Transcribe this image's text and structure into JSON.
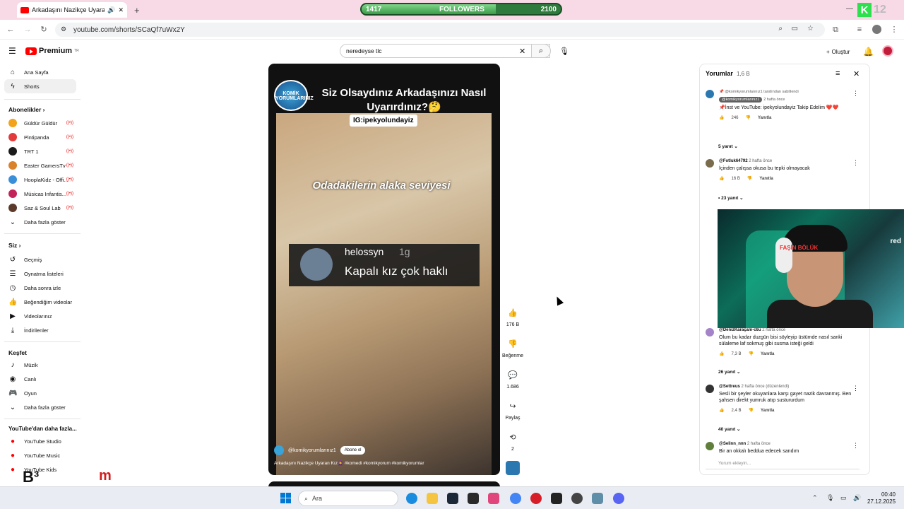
{
  "browser": {
    "tab_title": "Arkadaşını Nazikçe Uyaran",
    "url": "youtube.com/shorts/SCaQf7uWx2Y"
  },
  "stream_overlay": {
    "followers_label": "FOLLOWERS",
    "followers_current": "1417",
    "followers_goal": "2100",
    "followers_progress": 0.675,
    "corner_text": "12",
    "watermark_left": "B³",
    "watermark_right": "m"
  },
  "youtube": {
    "logo_text": "Premium",
    "logo_region": "TR",
    "search_value": "neredeyse  tlc",
    "create_label": "Oluştur"
  },
  "sidebar": {
    "main": [
      {
        "label": "Ana Sayfa",
        "icon": "home-icon"
      },
      {
        "label": "Shorts",
        "icon": "shorts-icon"
      }
    ],
    "subs_heading": "Abonelikler",
    "subs": [
      {
        "label": "Güldür Güldür",
        "color": "#f2a31b"
      },
      {
        "label": "Pintipanda",
        "color": "#e23b3b"
      },
      {
        "label": "TRT 1",
        "color": "#1a1a1a"
      },
      {
        "label": "Easter GamersTv",
        "color": "#d9822b"
      },
      {
        "label": "HooplaKidz - Offi...",
        "color": "#3a8fd9"
      },
      {
        "label": "Músicas Infantis...",
        "color": "#c2245a"
      },
      {
        "label": "Saz & Soul Lab",
        "color": "#5b3a2a"
      }
    ],
    "subs_more": "Daha fazla göster",
    "you_heading": "Siz",
    "you": [
      {
        "label": "Geçmiş",
        "icon": "history-icon"
      },
      {
        "label": "Oynatma listeleri",
        "icon": "playlist-icon"
      },
      {
        "label": "Daha sonra izle",
        "icon": "clock-icon"
      },
      {
        "label": "Beğendiğim videolar",
        "icon": "like-icon"
      },
      {
        "label": "Videolarınız",
        "icon": "video-icon"
      },
      {
        "label": "İndirilenler",
        "icon": "download-icon"
      }
    ],
    "explore_heading": "Keşfet",
    "explore": [
      {
        "label": "Müzik",
        "icon": "music-icon"
      },
      {
        "label": "Canlı",
        "icon": "live-icon"
      },
      {
        "label": "Oyun",
        "icon": "gamepad-icon"
      }
    ],
    "explore_more": "Daha fazla göster",
    "more_heading": "YouTube'dan daha fazla...",
    "more": [
      {
        "label": "YouTube Studio"
      },
      {
        "label": "YouTube Music"
      },
      {
        "label": "YouTube Kids"
      }
    ]
  },
  "video": {
    "title": "Siz Olsaydınız Arkadaşınızı Nasıl Uyarırdınız?🤔",
    "channel_badge": "KOMİK YORUMLARINIZ",
    "ig_tag": "IG:ipekyolundayiz",
    "overlay_text": "Odadakilerin alaka seviyesi",
    "comment_user": "helossyn",
    "comment_age": "1g",
    "comment_text": "Kapalı kız çok haklı",
    "channel_handle": "@komikyorumlarınız1",
    "subscribe_label": "Abone ol",
    "description": "Arkadaşını Nazikçe Uyaran Kız🧕 #komedi #komikyorum #komikyorumlar"
  },
  "actions": {
    "likes": "176 B",
    "dislike_label": "Beğenme",
    "comments": "1.686",
    "share_label": "Paylaş",
    "remix_count": "2"
  },
  "comments": {
    "heading": "Yorumlar",
    "count": "1,6 B",
    "pinned_by": "@komikyorumlarınız1 tarafından sabitlendi",
    "items": [
      {
        "author": "@komikyorumlarınız1",
        "ago": "2 hafta önce",
        "text": "📌İnst ve YouTube: ipekyolundayiz Takip Edelim ❤️❤️",
        "likes": "246",
        "reply": "Yanıtla",
        "replies": "5 yanıt"
      },
      {
        "author": "@Fotluk64792",
        "ago": "2 hafta önce",
        "text": "İçinden çalışsa okusa bu tepki olmayacak",
        "likes": "16 B",
        "reply": "Yanıtla",
        "replies": "23 yanıt"
      },
      {
        "author": "@DenizKaraçam-c6u",
        "ago": "2 hafta önce",
        "text": "Olum bu kadar duzgün bisi söyleyip üstümde nasıl sanki sülaleme laf sokmuş gibi susma isteği geldi",
        "likes": "7,3 B",
        "reply": "Yanıtla",
        "replies": "26 yanıt"
      },
      {
        "author": "@Settreus",
        "ago": "2 hafta önce (düzenlendi)",
        "text": "Sesli bir şeyler okuyanlara karşı gayet nazik davranmış. Ben şahsen direkt yumruk atıp sustururdum",
        "likes": "2,4 B",
        "reply": "Yanıtla",
        "replies": "40 yanıt"
      },
      {
        "author": "@Selinn_nnn",
        "ago": "2 hafta önce",
        "text": "Bir an okkalı beddua edecek sandım",
        "likes": "",
        "reply": "",
        "replies": ""
      }
    ],
    "input_placeholder": "Yorum ekleyin..."
  },
  "webcam": {
    "jersey_text": "FAŞİN BÖLÜK",
    "corner_text": "red"
  },
  "taskbar": {
    "search_placeholder": "Ara",
    "time": "00:40",
    "date": "27.12.2025"
  }
}
